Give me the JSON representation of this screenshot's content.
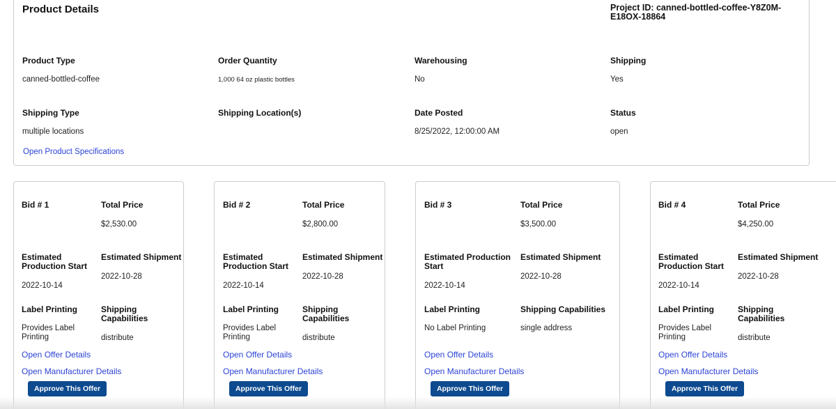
{
  "product": {
    "title": "Product Details",
    "project_id": "Project ID: canned-bottled-coffee-Y8Z0M-E18OX-18864",
    "fields": [
      {
        "label": "Product Type",
        "value": "canned-bottled-coffee"
      },
      {
        "label": "Order Quantity",
        "value": "1,000 64 oz plastic bottles"
      },
      {
        "label": "Warehousing",
        "value": "No"
      },
      {
        "label": "Shipping",
        "value": "Yes"
      },
      {
        "label": "Shipping Type",
        "value": "multiple locations"
      },
      {
        "label": "Shipping Location(s)",
        "value": ""
      },
      {
        "label": "Date Posted",
        "value": "8/25/2022, 12:00:00 AM"
      },
      {
        "label": "Status",
        "value": "open"
      }
    ],
    "spec_link": "Open Product Specifications"
  },
  "labels": {
    "total_price": "Total Price",
    "est_production": "Estimated Production Start",
    "est_shipment": "Estimated Shipment",
    "label_printing": "Label Printing",
    "shipping_capabilities": "Shipping Capabilities",
    "offer_link": "Open Offer Details",
    "manufacturer_link": "Open Manufacturer Details",
    "approve_button": "Approve This Offer"
  },
  "bids": [
    {
      "title": "Bid # 1",
      "price": "$2,530.00",
      "production_start": "2022-10-14",
      "shipment": "2022-10-28",
      "label_printing": "Provides Label Printing",
      "shipping_capabilities": "distribute"
    },
    {
      "title": "Bid # 2",
      "price": "$2,800.00",
      "production_start": "2022-10-14",
      "shipment": "2022-10-28",
      "label_printing": "Provides Label Printing",
      "shipping_capabilities": "distribute"
    },
    {
      "title": "Bid # 3",
      "price": "$3,500.00",
      "production_start": "2022-10-14",
      "shipment": "2022-10-28",
      "label_printing": "No Label Printing",
      "shipping_capabilities": "single address"
    },
    {
      "title": "Bid # 4",
      "price": "$4,250.00",
      "production_start": "2022-10-14",
      "shipment": "2022-10-28",
      "label_printing": "Provides Label Printing",
      "shipping_capabilities": "distribute"
    }
  ],
  "colors": {
    "link": "#2b43d6",
    "button": "#0d4a8f",
    "border": "#c9cdd2"
  }
}
